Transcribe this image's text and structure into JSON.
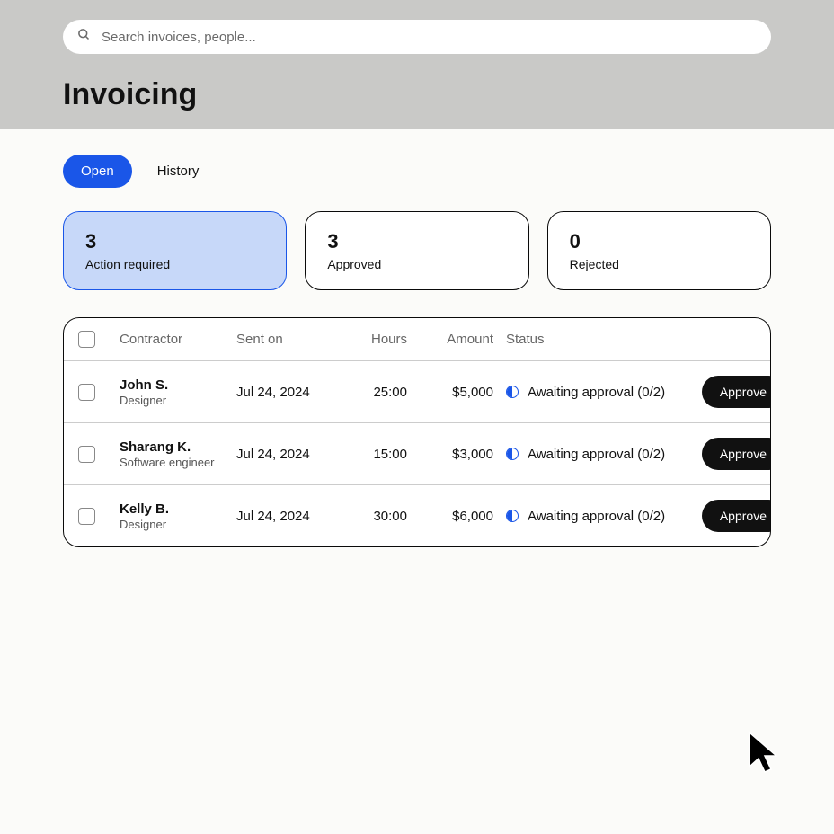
{
  "search": {
    "placeholder": "Search invoices, people..."
  },
  "page_title": "Invoicing",
  "tabs": [
    {
      "label": "Open",
      "active": true
    },
    {
      "label": "History",
      "active": false
    }
  ],
  "summary": [
    {
      "count": "3",
      "label": "Action required",
      "active": true
    },
    {
      "count": "3",
      "label": "Approved",
      "active": false
    },
    {
      "count": "0",
      "label": "Rejected",
      "active": false
    }
  ],
  "table": {
    "headers": {
      "contractor": "Contractor",
      "sent_on": "Sent on",
      "hours": "Hours",
      "amount": "Amount",
      "status": "Status"
    },
    "rows": [
      {
        "name": "John S.",
        "role": "Designer",
        "sent_on": "Jul 24, 2024",
        "hours": "25:00",
        "amount": "$5,000",
        "status": "Awaiting approval (0/2)",
        "action": "Approve"
      },
      {
        "name": "Sharang K.",
        "role": "Software engineer",
        "sent_on": "Jul 24, 2024",
        "hours": "15:00",
        "amount": "$3,000",
        "status": "Awaiting approval (0/2)",
        "action": "Approve"
      },
      {
        "name": "Kelly B.",
        "role": "Designer",
        "sent_on": "Jul 24, 2024",
        "hours": "30:00",
        "amount": "$6,000",
        "status": "Awaiting approval (0/2)",
        "action": "Approve"
      }
    ]
  }
}
